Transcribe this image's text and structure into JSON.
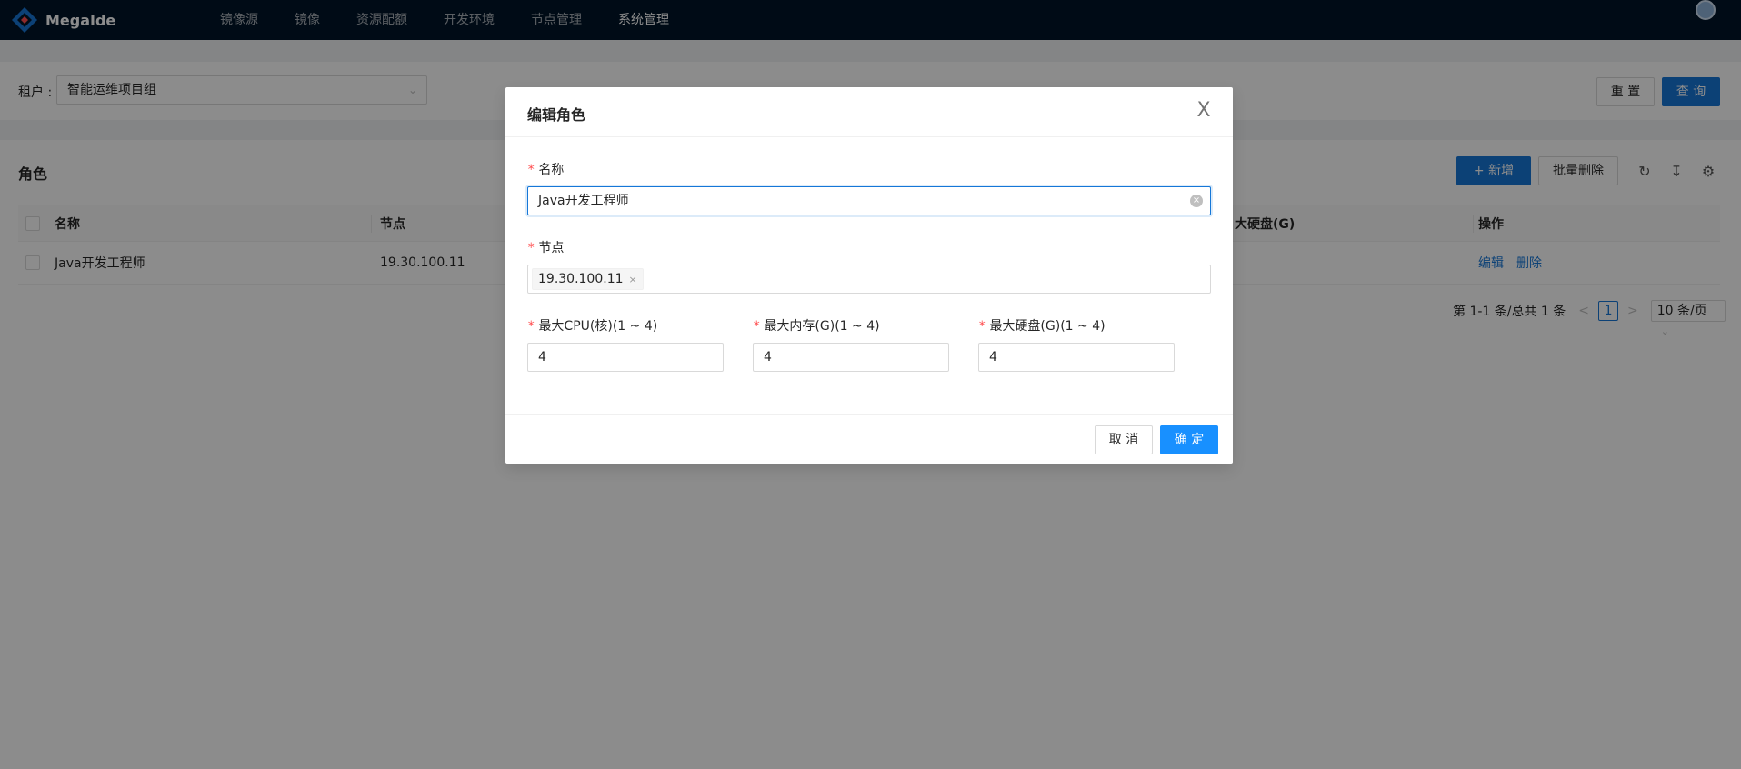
{
  "brand": {
    "name": "MegaIde"
  },
  "nav": {
    "items": [
      "镜像源",
      "镜像",
      "资源配额",
      "开发环境",
      "节点管理",
      "系统管理"
    ],
    "active": "系统管理"
  },
  "filter": {
    "tenant_label": "租户 :",
    "tenant_value": "智能运维项目组",
    "reset_label": "重 置",
    "query_label": "查 询"
  },
  "card": {
    "title": "角色",
    "add_label": "新增",
    "batch_delete_label": "批量删除"
  },
  "table": {
    "headers": {
      "name": "名称",
      "node": "节点",
      "disk": "大硬盘(G)",
      "action": "操作"
    },
    "rows": [
      {
        "name": "Java开发工程师",
        "node": "19.30.100.11",
        "edit": "编辑",
        "delete": "删除"
      }
    ]
  },
  "pagination": {
    "summary": "第 1-1 条/总共 1 条",
    "prev": "<",
    "current": "1",
    "next": ">",
    "page_size": "10 条/页"
  },
  "modal": {
    "title": "编辑角色",
    "close": "X",
    "name_label": "名称",
    "name_value": "Java开发工程师",
    "node_label": "节点",
    "node_tag": "19.30.100.11",
    "cpu_label": "最大CPU(核)(1 ~ 4)",
    "cpu_value": "4",
    "mem_label": "最大内存(G)(1 ~ 4)",
    "mem_value": "4",
    "disk_label": "最大硬盘(G)(1 ~ 4)",
    "disk_value": "4",
    "cancel_label": "取 消",
    "ok_label": "确 定"
  },
  "colors": {
    "primary": "#1677d8",
    "nav_bg": "#001529",
    "required": "#ff4d4f"
  },
  "icons": [
    "logo-icon",
    "avatar-icon",
    "chevron-down-icon",
    "plus-icon",
    "reload-icon",
    "column-height-icon",
    "setting-icon",
    "close-icon",
    "clear-circle-icon",
    "tag-close-icon"
  ]
}
